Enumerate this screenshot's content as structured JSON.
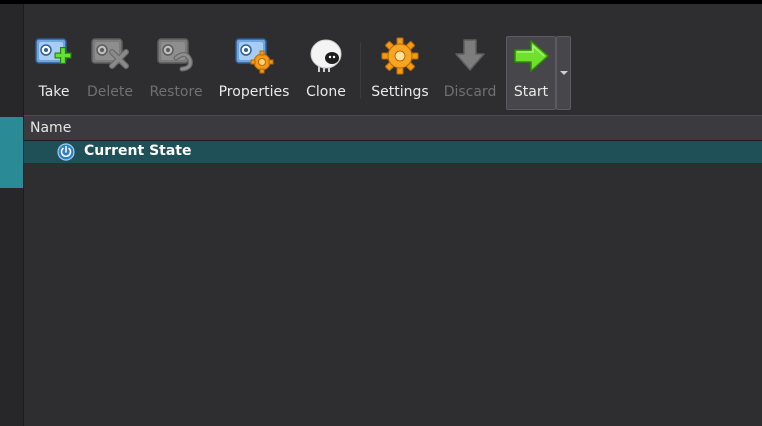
{
  "toolbar": {
    "take": {
      "label": "Take",
      "enabled": true,
      "icon": "snapshot-take-icon"
    },
    "delete": {
      "label": "Delete",
      "enabled": false,
      "icon": "snapshot-delete-icon"
    },
    "restore": {
      "label": "Restore",
      "enabled": false,
      "icon": "snapshot-restore-icon"
    },
    "properties": {
      "label": "Properties",
      "enabled": true,
      "icon": "snapshot-properties-icon"
    },
    "clone": {
      "label": "Clone",
      "enabled": true,
      "icon": "clone-sheep-icon"
    },
    "settings": {
      "label": "Settings",
      "enabled": true,
      "icon": "settings-gear-icon"
    },
    "discard": {
      "label": "Discard",
      "enabled": false,
      "icon": "discard-arrow-down-icon"
    },
    "start": {
      "label": "Start",
      "enabled": true,
      "icon": "start-arrow-right-icon"
    }
  },
  "tree": {
    "column_name": "Name",
    "rows": [
      {
        "label": "Current State",
        "icon": "power-icon",
        "selected": true
      }
    ]
  },
  "colors": {
    "background": "#2e2e31",
    "selection": "#1f4f57",
    "accent": "#2a8a96",
    "disabled_text": "#707074"
  }
}
